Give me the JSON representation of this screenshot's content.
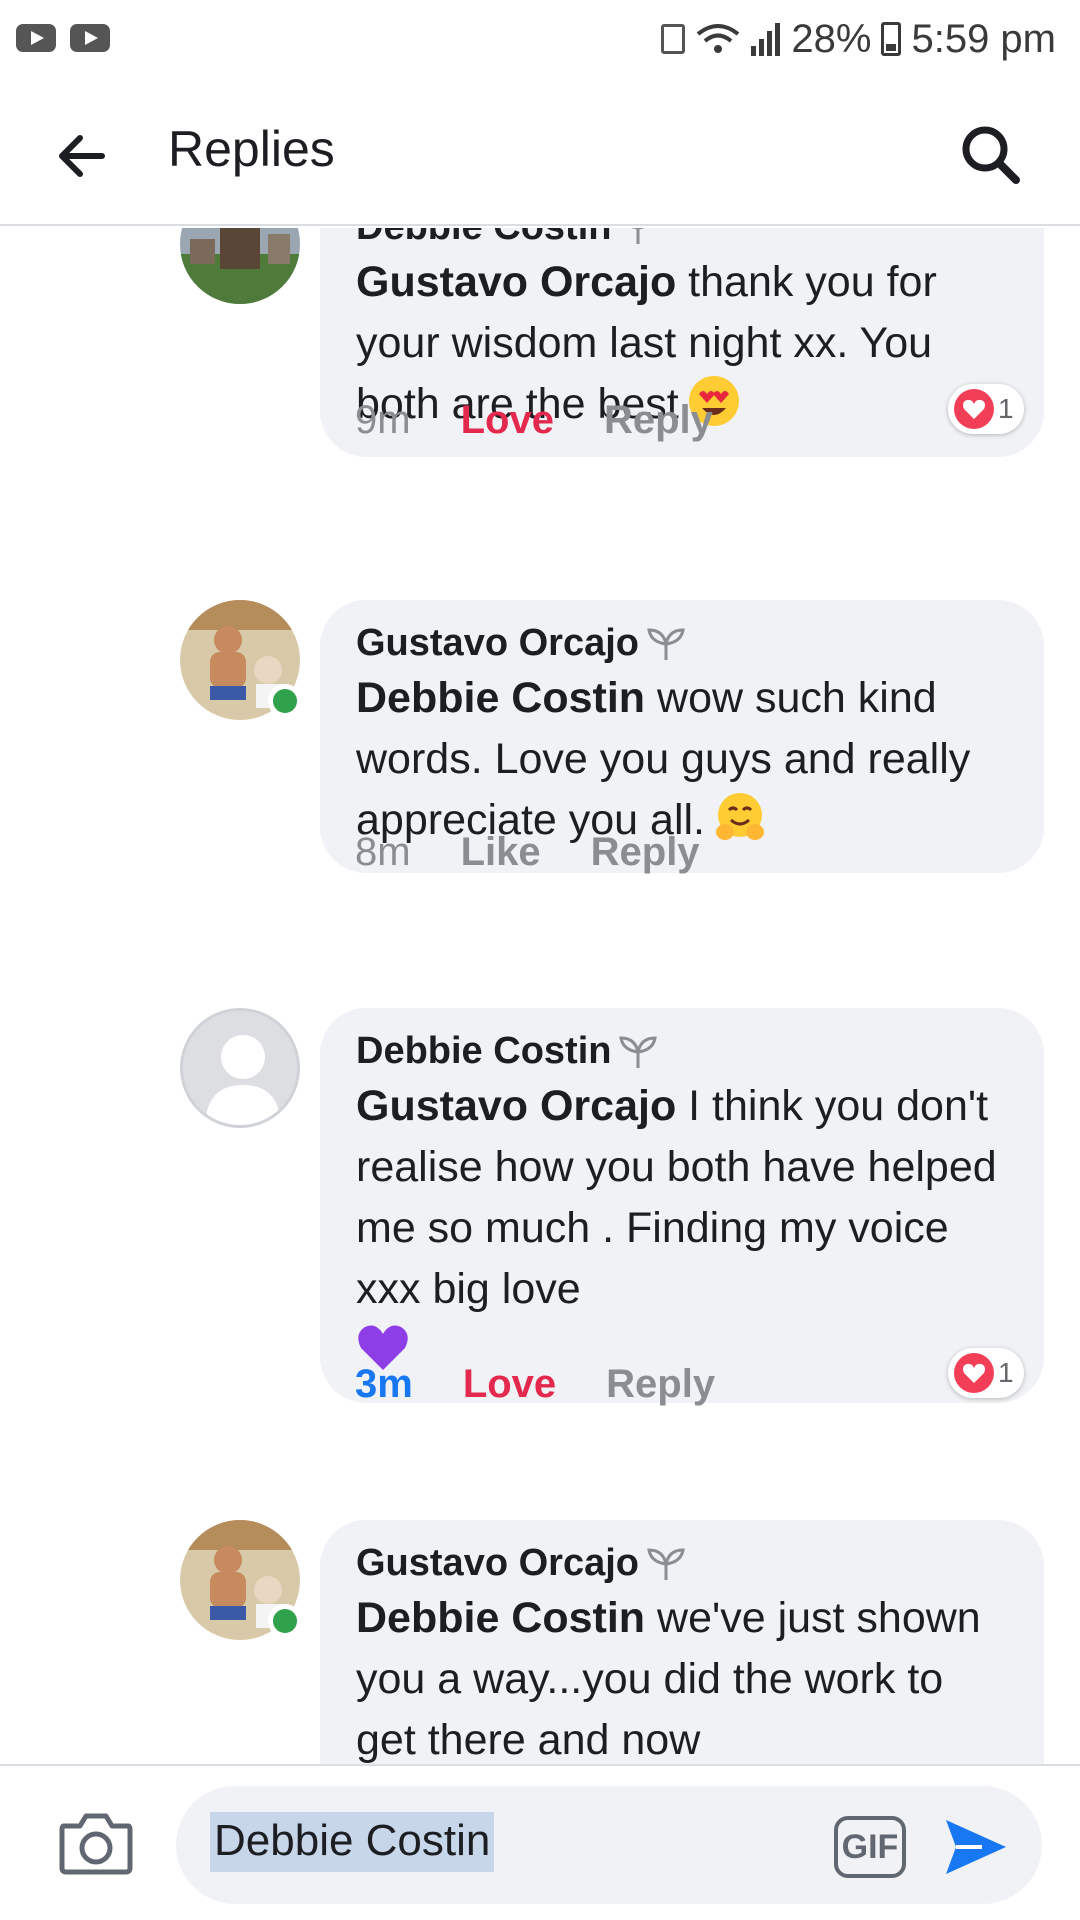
{
  "status_bar": {
    "battery": "28%",
    "time": "5:59 pm",
    "icons": [
      "youtube-icon",
      "youtube-icon",
      "recycle-icon",
      "wifi-icon",
      "signal-icon",
      "battery-icon"
    ]
  },
  "header": {
    "title": "Replies",
    "back_icon": "back-arrow-icon",
    "search_icon": "search-icon"
  },
  "comments": [
    {
      "author": "Debbie Costin",
      "mention": "Gustavo Orcajo",
      "text": " thank you for your wisdom last night xx. You both are the best",
      "emoji": "heart-eyes-emoji",
      "time": "9m",
      "reaction_label": "Love",
      "reply_label": "Reply",
      "reaction_count": "1"
    },
    {
      "author": "Gustavo Orcajo",
      "mention": "Debbie Costin",
      "text": " wow such kind words. Love you guys and really appreciate you all.",
      "emoji": "hugging-emoji",
      "time": "8m",
      "reaction_label": "Like",
      "reply_label": "Reply",
      "online": true
    },
    {
      "author": "Debbie Costin",
      "mention": "Gustavo Orcajo",
      "text": " I think you don't realise how you both have helped me so much . Finding my voice xxx big love",
      "emoji": "purple-heart-emoji",
      "time": "3m",
      "reaction_label": "Love",
      "reply_label": "Reply",
      "reaction_count": "1"
    },
    {
      "author": "Gustavo Orcajo",
      "mention": "Debbie Costin",
      "text": " we've just shown you a way...you did the work to get there and now",
      "online": true
    }
  ],
  "composer": {
    "input_value": "Debbie Costin",
    "gif_label": "GIF",
    "camera_icon": "camera-icon",
    "send_icon": "send-icon"
  },
  "colors": {
    "accent": "#1877f2",
    "love": "#e4294f",
    "bubble": "#f0f2f5",
    "online": "#31a24c"
  }
}
